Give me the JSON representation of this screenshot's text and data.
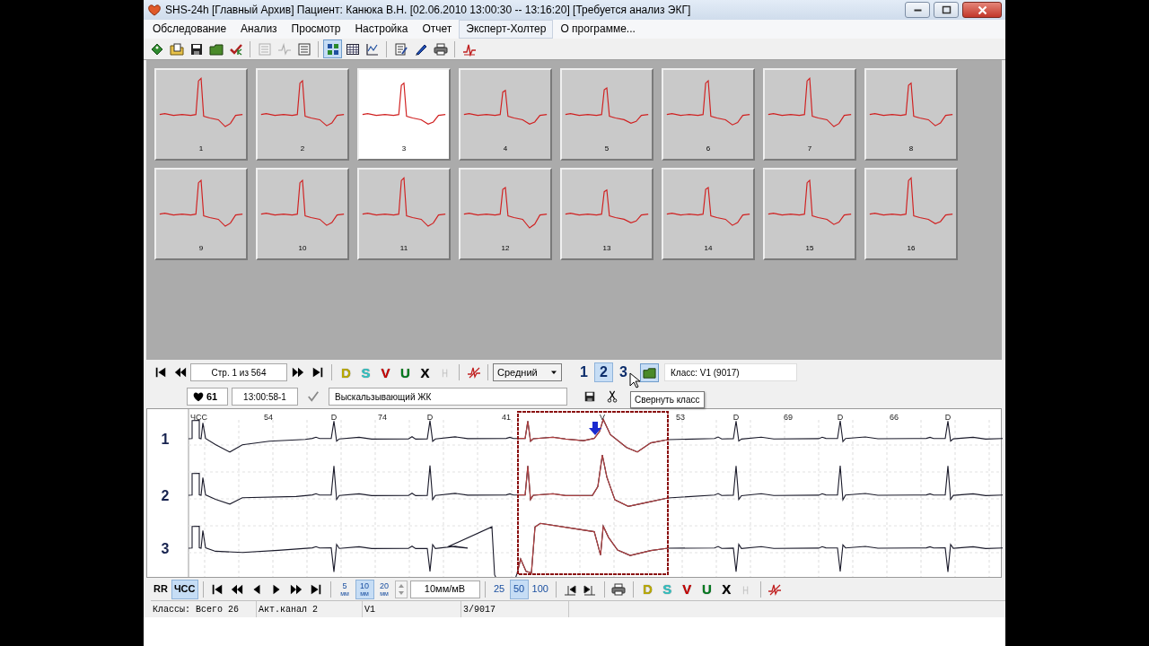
{
  "window": {
    "title": "SHS-24h [Главный Архив] Пациент: Канюка В.Н. [02.06.2010 13:00:30 -- 13:16:20] [Требуется анализ ЭКГ]"
  },
  "menu": [
    {
      "label": "Обследование",
      "selected": false
    },
    {
      "label": "Анализ",
      "selected": false
    },
    {
      "label": "Просмотр",
      "selected": false
    },
    {
      "label": "Настройка",
      "selected": false
    },
    {
      "label": "Отчет",
      "selected": false
    },
    {
      "label": "Эксперт-Холтер",
      "selected": true
    },
    {
      "label": "О программе...",
      "selected": false
    }
  ],
  "toolbar": [
    {
      "kind": "tag",
      "disabled": false,
      "selected": false
    },
    {
      "kind": "open",
      "disabled": false,
      "selected": false
    },
    {
      "kind": "save",
      "disabled": false,
      "selected": false
    },
    {
      "kind": "folder",
      "disabled": false,
      "selected": false
    },
    {
      "kind": "check",
      "disabled": false,
      "selected": false
    },
    {
      "kind": "separator"
    },
    {
      "kind": "list",
      "disabled": true,
      "selected": false
    },
    {
      "kind": "pulse",
      "disabled": true,
      "selected": false
    },
    {
      "kind": "list",
      "disabled": false,
      "selected": false
    },
    {
      "kind": "separator"
    },
    {
      "kind": "grid",
      "disabled": false,
      "selected": true
    },
    {
      "kind": "table",
      "disabled": false,
      "selected": false
    },
    {
      "kind": "chart",
      "disabled": false,
      "selected": false
    },
    {
      "kind": "separator"
    },
    {
      "kind": "note",
      "disabled": false,
      "selected": false
    },
    {
      "kind": "pen",
      "disabled": false,
      "selected": false
    },
    {
      "kind": "printer",
      "disabled": false,
      "selected": false
    },
    {
      "kind": "separator"
    },
    {
      "kind": "ecg",
      "disabled": false,
      "selected": false
    }
  ],
  "templates": [
    {
      "number": "1",
      "selected": false
    },
    {
      "number": "2",
      "selected": false
    },
    {
      "number": "3",
      "selected": true
    },
    {
      "number": "4",
      "selected": false
    },
    {
      "number": "5",
      "selected": false
    },
    {
      "number": "6",
      "selected": false
    },
    {
      "number": "7",
      "selected": false
    },
    {
      "number": "8",
      "selected": false
    },
    {
      "number": "9",
      "selected": false
    },
    {
      "number": "10",
      "selected": false
    },
    {
      "number": "11",
      "selected": false
    },
    {
      "number": "12",
      "selected": false
    },
    {
      "number": "13",
      "selected": false
    },
    {
      "number": "14",
      "selected": false
    },
    {
      "number": "15",
      "selected": false
    },
    {
      "number": "16",
      "selected": false
    }
  ],
  "class_bar": {
    "page": "Стр. 1 из 564",
    "class_letters": [
      {
        "letter": "D",
        "color": "#b8a800"
      },
      {
        "letter": "S",
        "color": "#2fc4c4"
      },
      {
        "letter": "V",
        "color": "#c80000"
      },
      {
        "letter": "U",
        "color": "#007a1e"
      },
      {
        "letter": "X",
        "color": "#000000"
      }
    ],
    "averaging": "Средний",
    "channels": [
      {
        "label": "1",
        "selected": false
      },
      {
        "label": "2",
        "selected": true
      },
      {
        "label": "3",
        "selected": false
      }
    ],
    "class_info": "Класс: V1 (9017)"
  },
  "beat_info": {
    "rate": "61",
    "time": "13:00:58-1",
    "label": "Выскальзывающий ЖК"
  },
  "tooltip": "Свернуть класс",
  "ecg": {
    "channels": [
      "1",
      "2",
      "3"
    ],
    "labels": [
      "ЧСС",
      "54",
      "D",
      "74",
      "D",
      "41",
      "V",
      "53",
      "D",
      "69",
      "D",
      "66",
      "D"
    ]
  },
  "bottom_bar": {
    "modes": [
      {
        "label": "RR",
        "selected": false
      },
      {
        "label": "ЧСС",
        "selected": true
      }
    ],
    "speeds": [
      {
        "value": "5",
        "unit": "мм",
        "selected": false
      },
      {
        "value": "10",
        "unit": "мм",
        "selected": true
      },
      {
        "value": "20",
        "unit": "мм",
        "selected": false
      }
    ],
    "gain": "10мм/мВ",
    "scales": [
      {
        "label": "25",
        "selected": false
      },
      {
        "label": "50",
        "selected": true
      },
      {
        "label": "100",
        "selected": false
      }
    ],
    "class_letters": [
      {
        "letter": "D",
        "color": "#b8a800"
      },
      {
        "letter": "S",
        "color": "#2fc4c4"
      },
      {
        "letter": "V",
        "color": "#c80000"
      },
      {
        "letter": "U",
        "color": "#007a1e"
      },
      {
        "letter": "X",
        "color": "#000000"
      }
    ]
  },
  "status_bar": [
    "Классы: Всего 26",
    "Акт.канал 2",
    "V1",
    "3/9017"
  ]
}
